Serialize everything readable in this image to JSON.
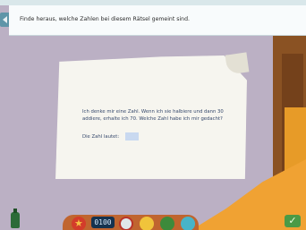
{
  "instruction": {
    "text": "Finde heraus, welche Zahlen bei diesem Rätsel gemeint sind."
  },
  "puzzle": {
    "riddle": "Ich denke mir eine Zahl. Wenn ich sie halbiere und dann 30 addiere, erhalte ich 70. Welche Zahl habe ich mir gedacht?",
    "answer_label": "Die Zahl lautet:",
    "answer_value": ""
  },
  "toolbar": {
    "clock": "0100",
    "icons": [
      "speaker-icon",
      "bottle-icon",
      "star-icon",
      "clock-display",
      "gauge-icon",
      "chat-icon",
      "note-icon",
      "dice-icon",
      "checkmark-icon"
    ]
  }
}
